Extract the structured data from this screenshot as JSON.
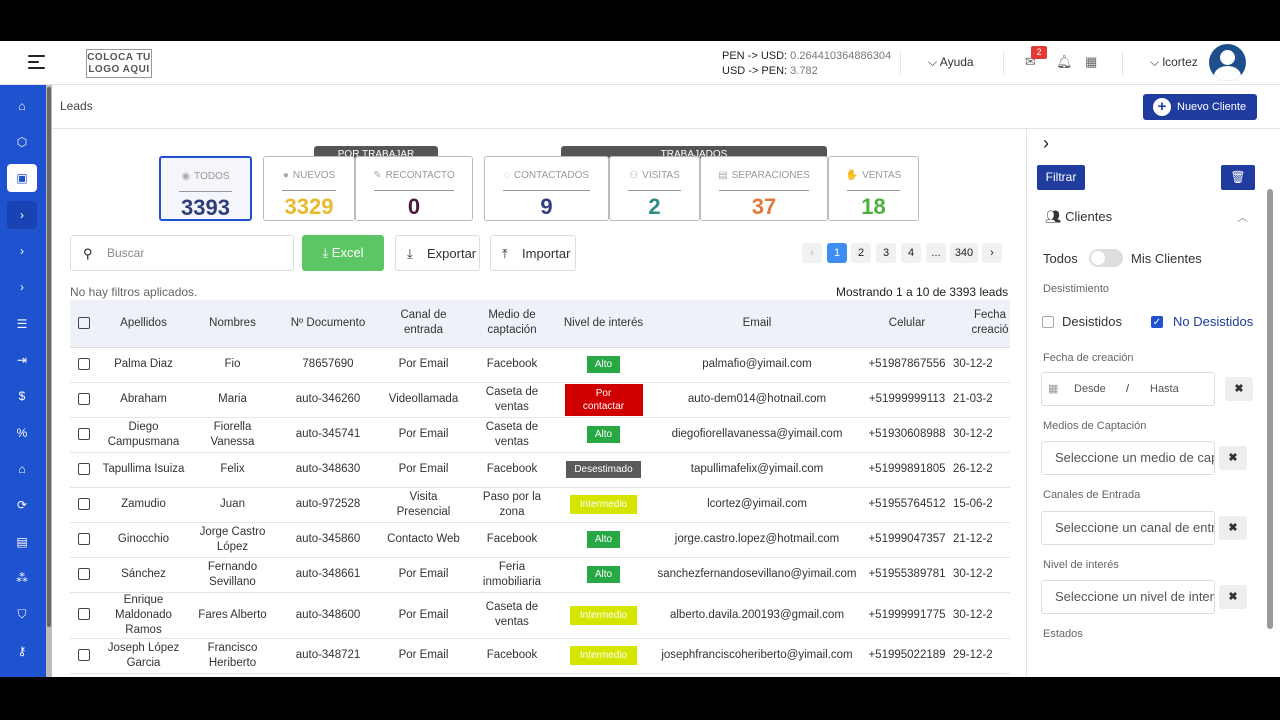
{
  "header": {
    "logo_line1": "COLOCA TU",
    "logo_line2": "LOGO AQUI",
    "rate1_label": "PEN -> USD:",
    "rate1_value": "0.264410364886304",
    "rate2_label": "USD -> PEN:",
    "rate2_value": "3.782",
    "help_label": "Ayuda",
    "mail_badge": "2",
    "user_name": "lcortez"
  },
  "breadcrumb": "Leads",
  "new_client_label": "Nuevo Cliente",
  "groups": {
    "por_trabajar": "POR TRABAJAR",
    "trabajados": "TRABAJADOS"
  },
  "stats": [
    {
      "label": "TODOS",
      "value": "3393",
      "color": "#2f3f7a"
    },
    {
      "label": "NUEVOS",
      "value": "3329",
      "color": "#e8b92c"
    },
    {
      "label": "RECONTACTO",
      "value": "0",
      "color": "#4a1a3a"
    },
    {
      "label": "CONTACTADOS",
      "value": "9",
      "color": "#2f3f7a"
    },
    {
      "label": "VISITAS",
      "value": "2",
      "color": "#2e8b86"
    },
    {
      "label": "SEPARACIONES",
      "value": "37",
      "color": "#e07a3c"
    },
    {
      "label": "VENTAS",
      "value": "18",
      "color": "#4caf3e"
    }
  ],
  "toolbar": {
    "search_placeholder": "Buscar",
    "excel_label": "Excel",
    "export_label": "Exportar",
    "import_label": "Importar"
  },
  "pagination": {
    "pages": [
      "1",
      "2",
      "3",
      "4",
      "...",
      "340"
    ],
    "current": "1",
    "prev": "‹",
    "next": "›"
  },
  "filters_text": "No hay filtros aplicados.",
  "showing_text": "Mostrando 1 a 10 de 3393 leads",
  "table": {
    "headers": [
      "Apellidos",
      "Nombres",
      "Nº Documento",
      "Canal de entrada",
      "Medio de captación",
      "Nivel de interés",
      "Email",
      "Celular",
      "Fecha creació"
    ],
    "rows": [
      {
        "apellidos": "Palma Diaz",
        "nombres": "Fio",
        "doc": "78657690",
        "canal": "Por Email",
        "medio": "Facebook",
        "nivel": "Alto",
        "email": "palmafio@yimail.com",
        "celular": "+51987867556",
        "fecha": "30-12-2"
      },
      {
        "apellidos": "Abraham",
        "nombres": "Maria",
        "doc": "auto-346260",
        "canal": "Videollamada",
        "medio": "Caseta de ventas",
        "nivel": "Por contactar",
        "email": "auto-dem014@hotnail.com",
        "celular": "+51999999113",
        "fecha": "21-03-2"
      },
      {
        "apellidos": "Diego Campusmana",
        "nombres": "Fiorella Vanessa",
        "doc": "auto-345741",
        "canal": "Por Email",
        "medio": "Caseta de ventas",
        "nivel": "Alto",
        "email": "diegofiorellavanessa@yimail.com",
        "celular": "+51930608988",
        "fecha": "30-12-2"
      },
      {
        "apellidos": "Tapullima Isuiza",
        "nombres": "Felix",
        "doc": "auto-348630",
        "canal": "Por Email",
        "medio": "Facebook",
        "nivel": "Desestimado",
        "email": "tapullimafelix@yimail.com",
        "celular": "+51999891805",
        "fecha": "26-12-2"
      },
      {
        "apellidos": "Zamudio",
        "nombres": "Juan",
        "doc": "auto-972528",
        "canal": "Visita Presencial",
        "medio": "Paso por la zona",
        "nivel": "Intermedio",
        "email": "lcortez@yimail.com",
        "celular": "+51955764512",
        "fecha": "15-06-2"
      },
      {
        "apellidos": "Ginocchio",
        "nombres": "Jorge Castro López",
        "doc": "auto-345860",
        "canal": "Contacto Web",
        "medio": "Facebook",
        "nivel": "Alto",
        "email": "jorge.castro.lopez@hotmail.com",
        "celular": "+51999047357",
        "fecha": "21-12-2"
      },
      {
        "apellidos": "Sánchez",
        "nombres": "Fernando Sevillano",
        "doc": "auto-348661",
        "canal": "Por Email",
        "medio": "Feria inmobiliaria",
        "nivel": "Alto",
        "email": "sanchezfernandosevillano@yimail.com",
        "celular": "+51955389781",
        "fecha": "30-12-2"
      },
      {
        "apellidos": "Enrique Maldonado Ramos",
        "nombres": "Fares Alberto",
        "doc": "auto-348600",
        "canal": "Por Email",
        "medio": "Caseta de ventas",
        "nivel": "Intermedio",
        "email": "alberto.davila.200193@gmail.com",
        "celular": "+51999991775",
        "fecha": "30-12-2"
      },
      {
        "apellidos": "Joseph López Garcia",
        "nombres": "Francisco Heriberto",
        "doc": "auto-348721",
        "canal": "Por Email",
        "medio": "Facebook",
        "nivel": "Intermedio",
        "email": "josephfranciscoheriberto@yimail.com",
        "celular": "+51995022189",
        "fecha": "29-12-2"
      }
    ]
  },
  "level_colors": {
    "Alto": "#28a745",
    "Por contactar": "#d00000",
    "Desestimado": "#5a5a5a",
    "Intermedio": "#d4e600"
  },
  "filters_panel": {
    "filter_button": "Filtrar",
    "section_title": "Clientes",
    "toggle_left": "Todos",
    "toggle_right": "Mis Clientes",
    "desistimiento_label": "Desistimiento",
    "desistidos": "Desistidos",
    "no_desistidos": "No Desistidos",
    "fecha_label": "Fecha de creación",
    "desde": "Desde",
    "date_sep": "/",
    "hasta": "Hasta",
    "medios_label": "Medios de Captación",
    "medios_placeholder": "Seleccione un medio de captación",
    "canales_label": "Canales de Entrada",
    "canales_placeholder": "Seleccione un canal de entrada",
    "nivel_label": "Nivel de interés",
    "nivel_placeholder": "Seleccione un nivel de interés",
    "estados_label": "Estados"
  }
}
